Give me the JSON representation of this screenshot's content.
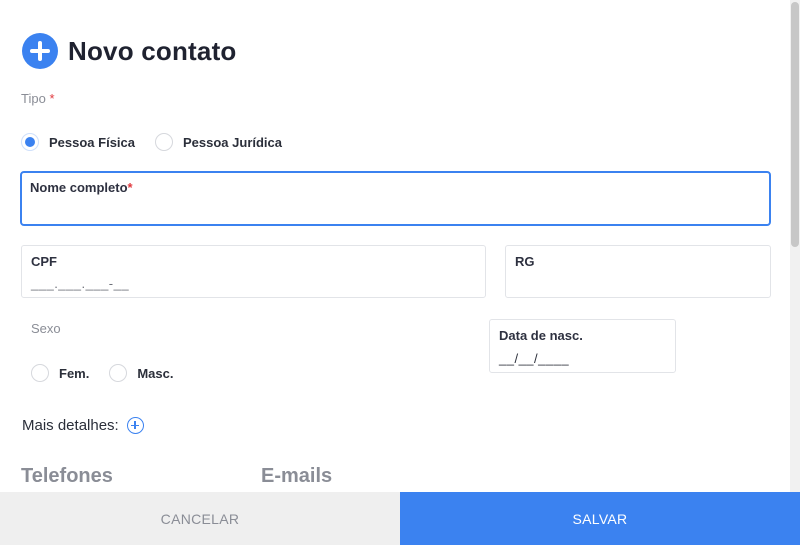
{
  "title": "Novo contato",
  "tipo": {
    "label": "Tipo",
    "required_mark": "*",
    "options": [
      "Pessoa Física",
      "Pessoa Jurídica"
    ],
    "selected": "Pessoa Física"
  },
  "nome": {
    "label": "Nome completo",
    "required_mark": "*",
    "value": ""
  },
  "cpf": {
    "label": "CPF",
    "value": "___.___.___-__"
  },
  "rg": {
    "label": "RG",
    "value": ""
  },
  "sexo": {
    "label": "Sexo",
    "options": [
      "Fem.",
      "Masc."
    ]
  },
  "nascimento": {
    "label": "Data de nasc.",
    "value": "__/__/____"
  },
  "mais_detalhes": {
    "label": "Mais detalhes:"
  },
  "sections": {
    "telefones": "Telefones",
    "emails": "E-mails"
  },
  "footer": {
    "cancel_label": "CANCELAR",
    "save_label": "SALVAR"
  },
  "colors": {
    "accent": "#3b82f0",
    "required": "#e0393e",
    "cancel_bg": "#efefef"
  },
  "icons": {
    "title": "plus-circle-icon",
    "mais": "plus-circle-outline-icon"
  }
}
